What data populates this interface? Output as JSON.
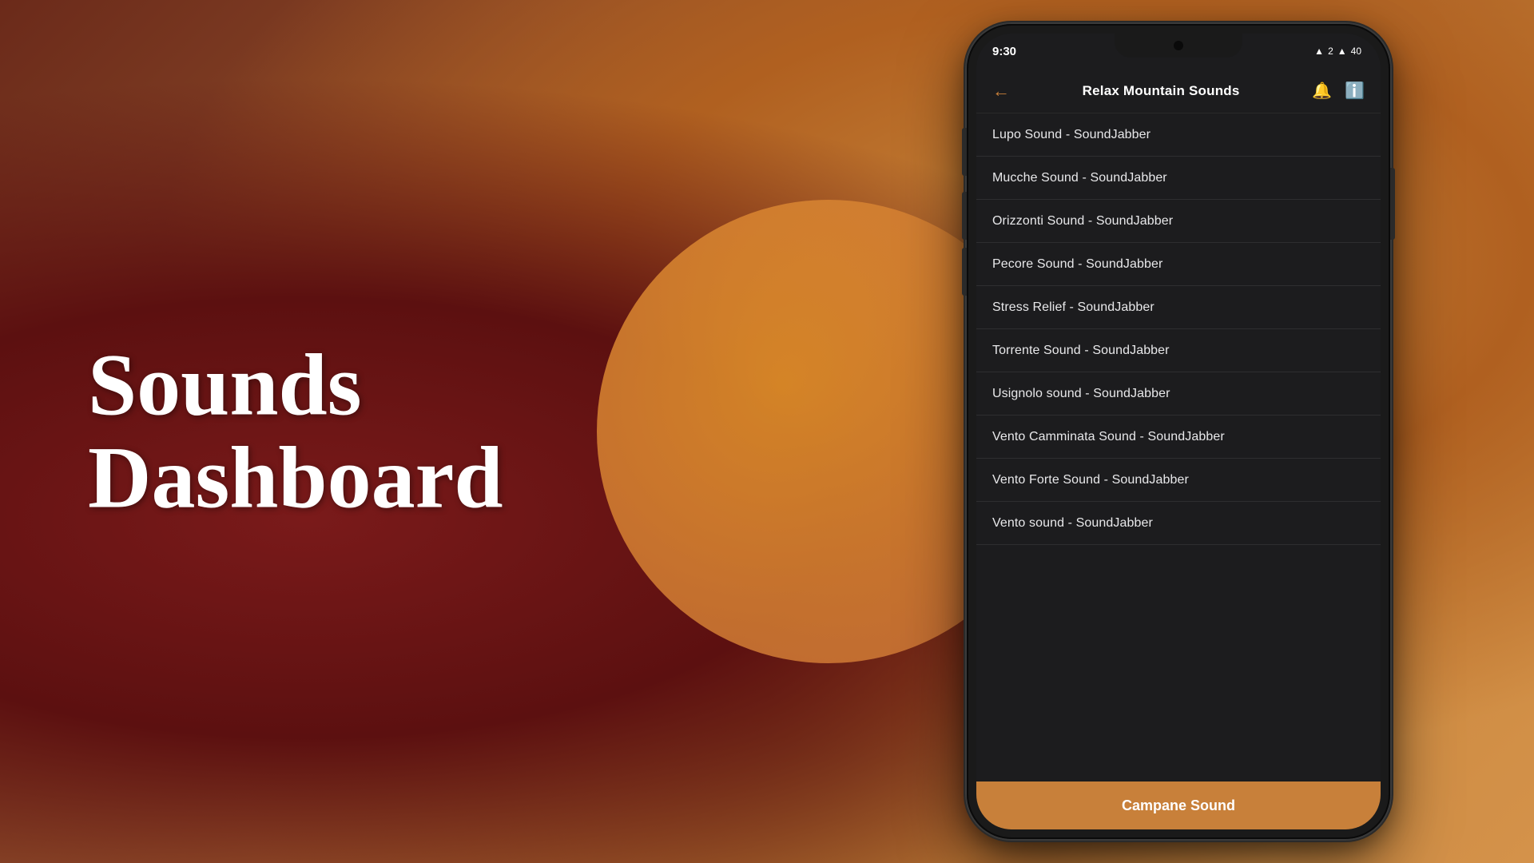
{
  "background": {
    "alt": "blurred warm mountain background"
  },
  "left_text": {
    "line1": "Sounds",
    "line2": "Dashboard"
  },
  "phone": {
    "status_bar": {
      "time": "9:30",
      "icons": "▲ 2 ▲ 40"
    },
    "header": {
      "back_icon": "←",
      "title": "Relax Mountain Sounds",
      "bell_icon": "🔔",
      "info_icon": "ℹ"
    },
    "sound_items": [
      {
        "id": 1,
        "label": "Lupo Sound - SoundJabber"
      },
      {
        "id": 2,
        "label": "Mucche Sound - SoundJabber"
      },
      {
        "id": 3,
        "label": "Orizzonti Sound - SoundJabber"
      },
      {
        "id": 4,
        "label": "Pecore Sound - SoundJabber"
      },
      {
        "id": 5,
        "label": "Stress Relief - SoundJabber"
      },
      {
        "id": 6,
        "label": "Torrente Sound - SoundJabber"
      },
      {
        "id": 7,
        "label": "Usignolo sound - SoundJabber"
      },
      {
        "id": 8,
        "label": "Vento Camminata Sound - SoundJabber"
      },
      {
        "id": 9,
        "label": "Vento Forte Sound - SoundJabber"
      },
      {
        "id": 10,
        "label": "Vento sound - SoundJabber"
      }
    ],
    "bottom_bar": {
      "label": "Campane Sound"
    }
  }
}
